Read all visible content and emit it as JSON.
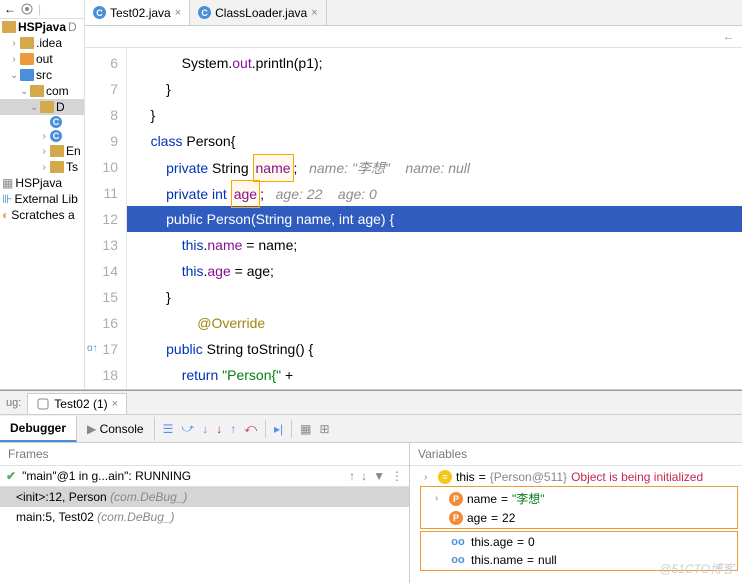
{
  "tabs": [
    {
      "label": "Test02.java",
      "active": true
    },
    {
      "label": "ClassLoader.java",
      "active": false
    }
  ],
  "project": {
    "root": "HSPjava",
    "rootSuffix": "D",
    "items": [
      {
        "ind": 1,
        "chev": ">",
        "icon": "folder",
        "label": ".idea"
      },
      {
        "ind": 1,
        "chev": ">",
        "icon": "out",
        "label": "out"
      },
      {
        "ind": 1,
        "chev": "v",
        "icon": "blue",
        "label": "src"
      },
      {
        "ind": 2,
        "chev": "v",
        "icon": "folder",
        "label": "com"
      },
      {
        "ind": 3,
        "chev": "v",
        "icon": "folder",
        "label": "D"
      },
      {
        "ind": 4,
        "chev": "",
        "icon": "c",
        "label": ""
      },
      {
        "ind": 4,
        "chev": ">",
        "icon": "c",
        "label": ""
      },
      {
        "ind": 4,
        "chev": ">",
        "icon": "folder",
        "label": "En"
      },
      {
        "ind": 4,
        "chev": ">",
        "icon": "folder",
        "label": "Ts"
      }
    ],
    "ext1": "HSPjava",
    "ext2": "External Lib",
    "ext3": "Scratches a"
  },
  "gutter": [
    "6",
    "7",
    "8",
    "9",
    "10",
    "11",
    "12",
    "13",
    "14",
    "15",
    "16",
    "17",
    "18"
  ],
  "code": {
    "l6": "            System.out.println(p1);",
    "l6_out": "out",
    "l7": "        }",
    "l8": "    }",
    "l9": "class Person{",
    "l9_kw": "class",
    "l10_kw": "private",
    "l10_rest": " String ",
    "l10_fld": "name",
    "l10_cm1": "name: \"李想\"",
    "l10_cm2": "name: null",
    "l11_kw": "private int",
    "l11_fld": "age",
    "l11_cm1": "age: 22",
    "l11_cm2": "age: 0",
    "l12_kw1": "public",
    "l12_mid": " Person(String name, ",
    "l12_kw2": "int",
    "l12_end": " age) {",
    "l13": "            this.name = name;",
    "l13_fld": "name",
    "l13_kw": "this",
    "l14": "            this.age = age;",
    "l14_fld": "age",
    "l14_kw": "this",
    "l15": "        }",
    "l16": "        @Override",
    "l17_kw": "public",
    "l17_rest": " String toString() {",
    "l18_kw": "return",
    "l18_str": "\"Person{\"",
    "l18_end": " +"
  },
  "debug": {
    "bugLabel": "ug:",
    "tabLabel": "Test02 (1)",
    "subtabs": {
      "debugger": "Debugger",
      "console": "Console"
    },
    "framesHeader": "Frames",
    "thread": "\"main\"@1 in g...ain\": RUNNING",
    "stack": [
      "<init>:12, Person (com.DeBug_)",
      "main:5, Test02 (com.DeBug_)"
    ],
    "varsHeader": "Variables",
    "this_lbl": "this",
    "this_val": "{Person@511}",
    "this_msg": "Object is being initialized",
    "name_lbl": "name",
    "name_val": "\"李想\"",
    "age_lbl": "age",
    "age_val": "22",
    "thisage_lbl": "this.age",
    "thisage_val": "0",
    "thisname_lbl": "this.name",
    "thisname_val": "null"
  },
  "watermark": "@51CTO博客"
}
